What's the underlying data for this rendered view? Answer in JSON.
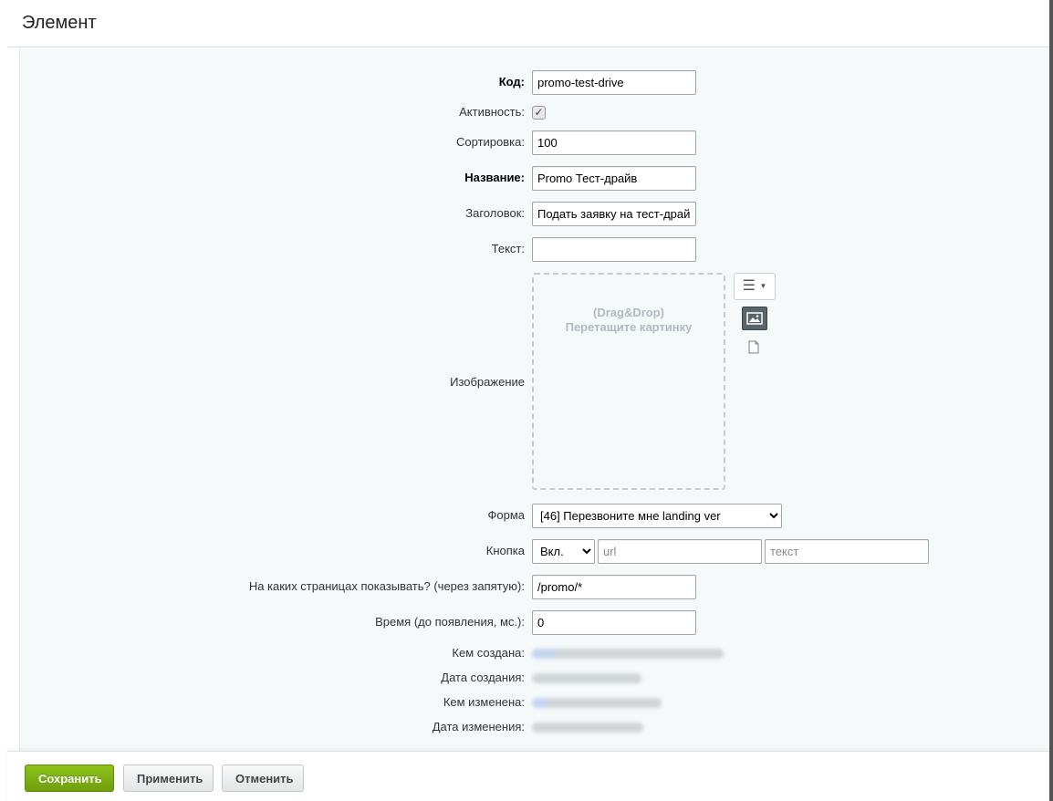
{
  "window": {
    "title": "Элемент"
  },
  "fields": {
    "code": {
      "label": "Код:",
      "value": "promo-test-drive"
    },
    "active": {
      "label": "Активность:",
      "checked": true
    },
    "sort": {
      "label": "Сортировка:",
      "value": "100"
    },
    "name": {
      "label": "Название:",
      "value": "Promo Тест-драйв"
    },
    "heading": {
      "label": "Заголовок:",
      "value": "Подать заявку на тест-драйв"
    },
    "text": {
      "label": "Текст:",
      "value": ""
    },
    "image": {
      "label": "Изображение",
      "dropzone_line1": "(Drag&Drop)",
      "dropzone_line2": "Перетащите картинку"
    },
    "form": {
      "label": "Форма",
      "selected": "[46] Перезвоните мне landing ver"
    },
    "button": {
      "label": "Кнопка",
      "state": "Вкл.",
      "url_placeholder": "url",
      "text_placeholder": "текст"
    },
    "pages": {
      "label": "На каких страницах показывать? (через запятую):",
      "value": "/promo/*"
    },
    "delay": {
      "label": "Время (до появления, мс.):",
      "value": "0"
    },
    "created_by": {
      "label": "Кем создана:"
    },
    "created_at": {
      "label": "Дата создания:"
    },
    "modified_by": {
      "label": "Кем изменена:"
    },
    "modified_at": {
      "label": "Дата изменения:"
    }
  },
  "footer": {
    "save_label": "Сохранить",
    "apply_label": "Применить",
    "cancel_label": "Отменить"
  },
  "colors": {
    "save_button": "#7cb213",
    "content_bg": "#f5f9f9"
  },
  "icons": [
    "menu-lines-icon",
    "image-icon",
    "file-icon",
    "checkmark-icon",
    "chevron-down-icon"
  ]
}
